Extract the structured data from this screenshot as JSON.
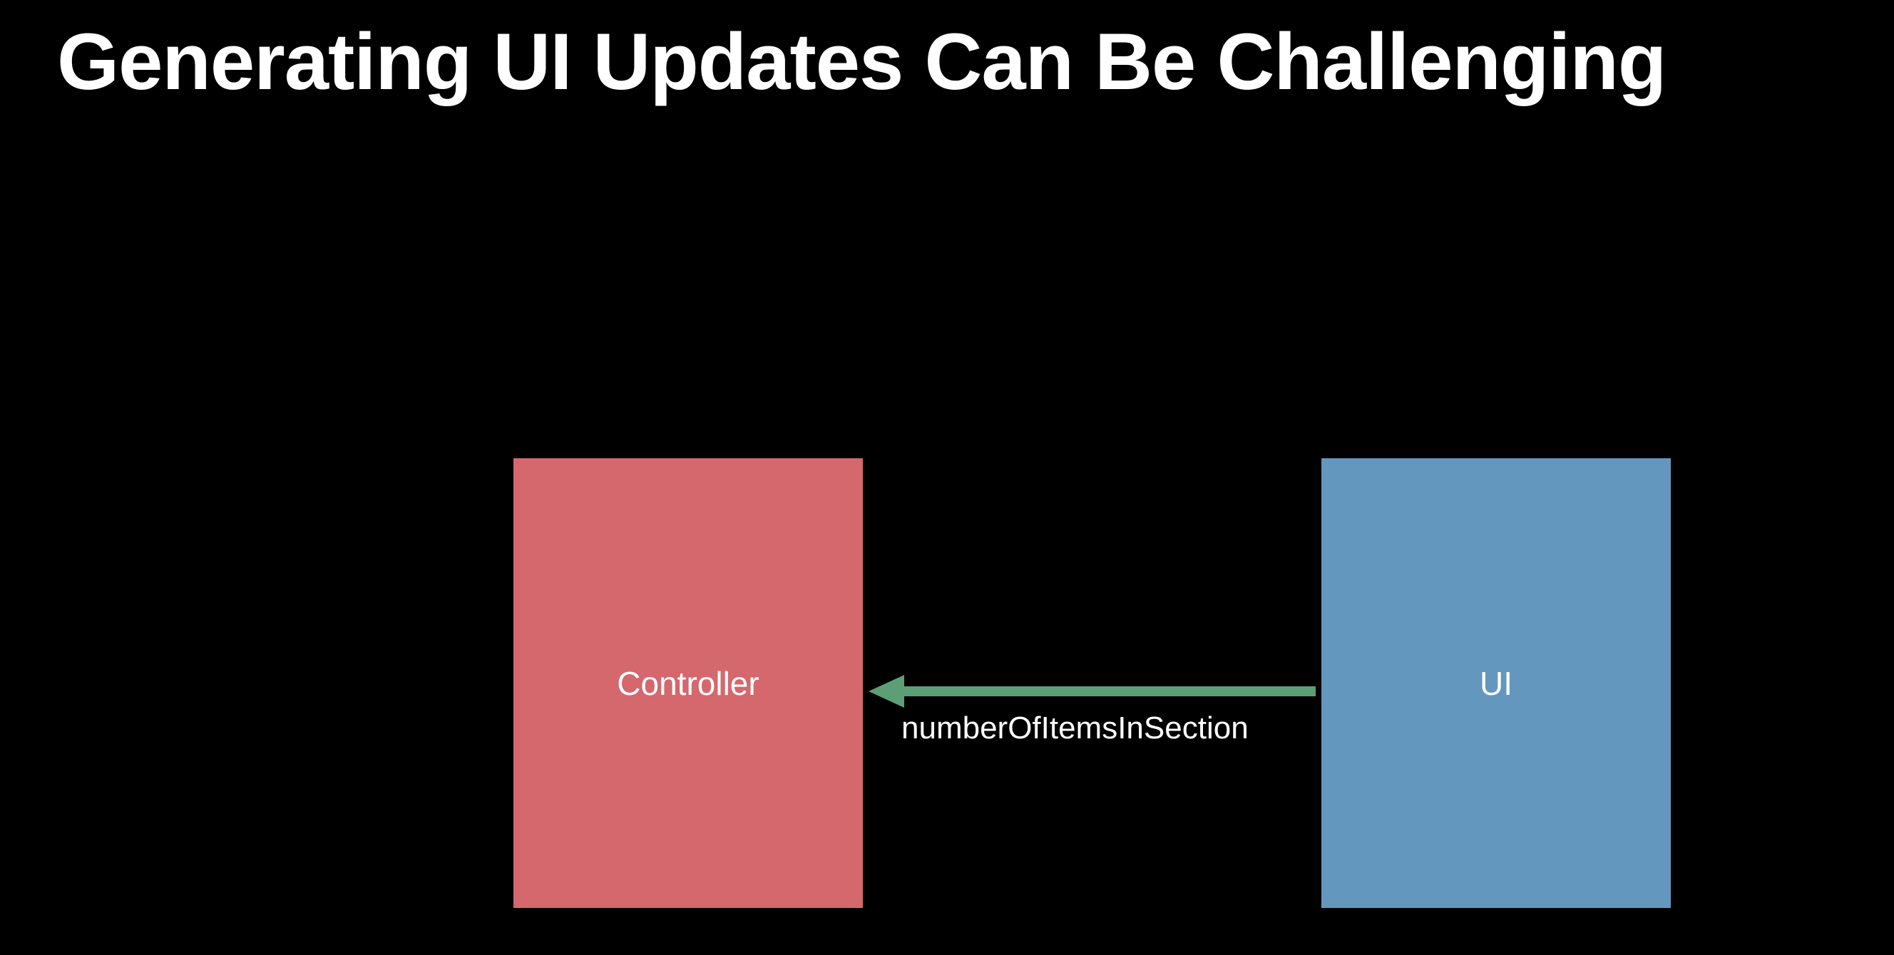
{
  "title": "Generating UI Updates Can Be Challenging",
  "diagram": {
    "controller": {
      "label": "Controller",
      "color": "#d4686d"
    },
    "ui": {
      "label": "UI",
      "color": "#6497bd"
    },
    "arrow": {
      "label": "numberOfItemsInSection",
      "color": "#5d9f75",
      "direction": "ui-to-controller"
    }
  }
}
